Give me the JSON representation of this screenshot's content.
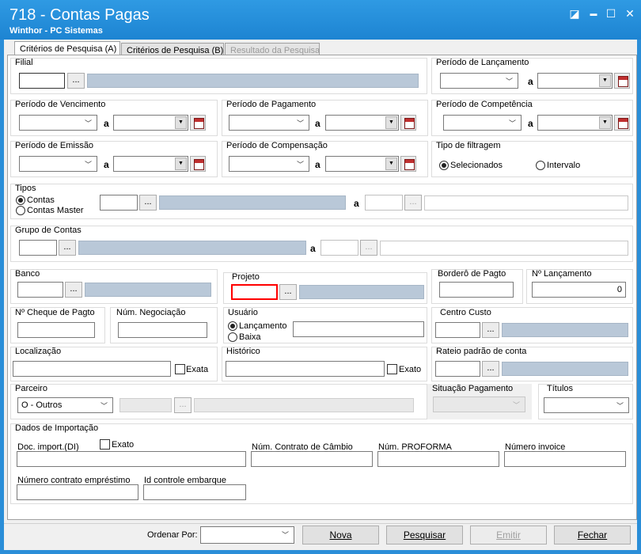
{
  "window": {
    "title": "718 - Contas Pagas",
    "subtitle": "Winthor - PC Sistemas",
    "restore_glyph": "◪",
    "min_glyph": "▬",
    "max_glyph": "☐",
    "close_glyph": "✕"
  },
  "tabs": [
    {
      "label": "Critérios de Pesquisa (A)"
    },
    {
      "label": "Critérios de Pesquisa (B)"
    },
    {
      "label": "Resultado da Pesquisa"
    }
  ],
  "common": {
    "dots": "...",
    "to": "a"
  },
  "filial": {
    "label": "Filial"
  },
  "periodo_lancamento": {
    "label": "Período de Lançamento"
  },
  "periodo_vencimento": {
    "label": "Período de Vencimento"
  },
  "periodo_pagamento": {
    "label": "Período de Pagamento"
  },
  "periodo_competencia": {
    "label": "Período de Competência"
  },
  "periodo_emissao": {
    "label": "Período de Emissão"
  },
  "periodo_compensacao": {
    "label": "Período de Compensação"
  },
  "tipo_filtragem": {
    "label": "Tipo de filtragem",
    "opt1": "Selecionados",
    "opt2": "Intervalo"
  },
  "tipos": {
    "label": "Tipos",
    "opt1": "Contas",
    "opt2": "Contas Master"
  },
  "grupo_contas": {
    "label": "Grupo de Contas"
  },
  "banco": {
    "label": "Banco"
  },
  "projeto": {
    "label": "Projeto"
  },
  "bordero": {
    "label": "Borderô de Pagto"
  },
  "num_lancamento": {
    "label": "Nº Lançamento",
    "value": "0"
  },
  "cheque": {
    "label": "Nº Cheque de Pagto"
  },
  "negociacao": {
    "label": "Núm. Negociação"
  },
  "usuario": {
    "label": "Usuário",
    "opt1": "Lançamento",
    "opt2": "Baixa"
  },
  "centro_custo": {
    "label": "Centro Custo"
  },
  "localizacao": {
    "label": "Localização",
    "exato": "Exata"
  },
  "historico": {
    "label": "Histórico",
    "exato": "Exato"
  },
  "rateio": {
    "label": "Rateio padrão de conta"
  },
  "parceiro": {
    "label": "Parceiro",
    "value": "O - Outros"
  },
  "situacao": {
    "label": "Situação Pagamento"
  },
  "titulos": {
    "label": "Títulos"
  },
  "importacao": {
    "label": "Dados de Importação",
    "doc": "Doc. import.(DI)",
    "exato": "Exato",
    "contrato_cambio": "Núm. Contrato de Câmbio",
    "proforma": "Núm. PROFORMA",
    "invoice": "Número invoice",
    "emprestimo": "Número contrato empréstimo",
    "embarque": "Id controle embarque"
  },
  "footer": {
    "ordenar": "Ordenar Por:",
    "nova": "Nova",
    "pesquisar": "Pesquisar",
    "emitir": "Emitir",
    "fechar": "Fechar"
  }
}
